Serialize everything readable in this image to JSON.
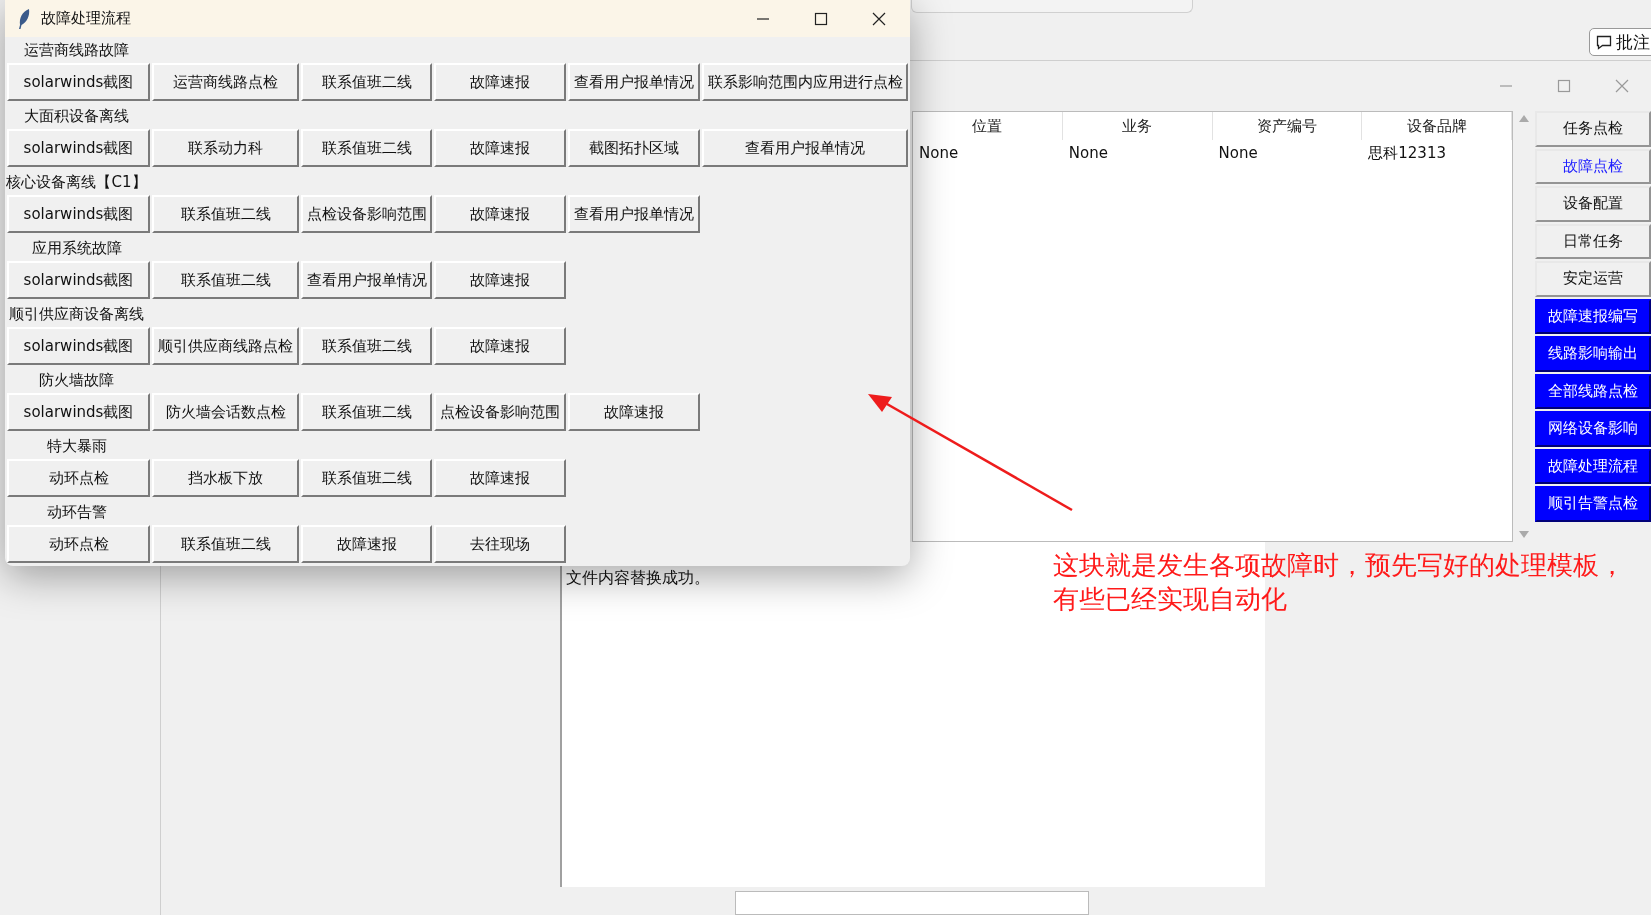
{
  "dialog": {
    "title": "故障处理流程",
    "sections": [
      {
        "label": "运营商线路故障",
        "buttons": [
          "solarwinds截图",
          "运营商线路点检",
          "联系值班二线",
          "故障速报",
          "查看用户报单情况",
          "联系影响范围内应用进行点检"
        ]
      },
      {
        "label": "大面积设备离线",
        "buttons": [
          "solarwinds截图",
          "联系动力科",
          "联系值班二线",
          "故障速报",
          "截图拓扑区域",
          "查看用户报单情况"
        ]
      },
      {
        "label": "核心设备离线【C1】",
        "buttons": [
          "solarwinds截图",
          "联系值班二线",
          "点检设备影响范围",
          "故障速报",
          "查看用户报单情况"
        ]
      },
      {
        "label": "应用系统故障",
        "buttons": [
          "solarwinds截图",
          "联系值班二线",
          "查看用户报单情况",
          "故障速报"
        ]
      },
      {
        "label": "顺引供应商设备离线",
        "buttons": [
          "solarwinds截图",
          "顺引供应商线路点检",
          "联系值班二线",
          "故障速报"
        ]
      },
      {
        "label": "防火墙故障",
        "buttons": [
          "solarwinds截图",
          "防火墙会话数点检",
          "联系值班二线",
          "点检设备影响范围",
          "故障速报"
        ]
      },
      {
        "label": "特大暴雨",
        "buttons": [
          "动环点检",
          "挡水板下放",
          "联系值班二线",
          "故障速报"
        ]
      },
      {
        "label": "动环告警",
        "buttons": [
          "动环点检",
          "联系值班二线",
          "故障速报",
          "去往现场"
        ]
      }
    ]
  },
  "main_window": {
    "table": {
      "columns": [
        "位置",
        "业务",
        "资产编号",
        "设备品牌"
      ],
      "rows": [
        [
          "None",
          "None",
          "None",
          "思科12313"
        ]
      ]
    },
    "side_buttons": [
      {
        "label": "任务点检",
        "kind": "plain"
      },
      {
        "label": "故障点检",
        "kind": "link"
      },
      {
        "label": "设备配置",
        "kind": "plain"
      },
      {
        "label": "日常任务",
        "kind": "plain"
      },
      {
        "label": "安定运营",
        "kind": "plain"
      },
      {
        "label": "故障速报编写",
        "kind": "filled"
      },
      {
        "label": "线路影响输出",
        "kind": "filled"
      },
      {
        "label": "全部线路点检",
        "kind": "filled"
      },
      {
        "label": "网络设备影响",
        "kind": "filled"
      },
      {
        "label": "故障处理流程",
        "kind": "filled"
      },
      {
        "label": "顺引告警点检",
        "kind": "filled"
      }
    ],
    "log": {
      "text": "文件内容替换成功。"
    }
  },
  "toolbar": {
    "comment_button": "批注"
  },
  "annotation": {
    "text": "这块就是发生各项故障时，预先写好的处理模板，有些已经实现自动化"
  }
}
